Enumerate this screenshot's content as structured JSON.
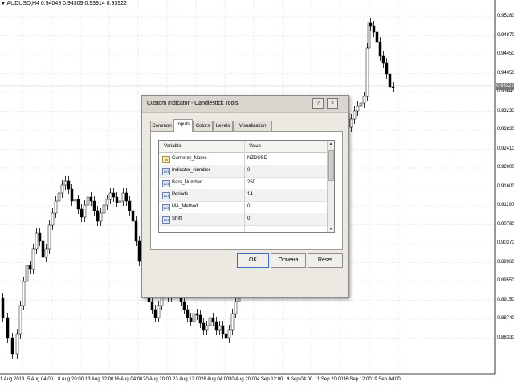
{
  "chart": {
    "symbol_line": "AUDUSD,H4  0.94049 0.94309 0.93914 0.93922",
    "current_price": "0.93922",
    "price_labels": [
      "0.95280",
      "0.94870",
      "0.94450",
      "0.94050",
      "0.93640",
      "0.93230",
      "0.92820",
      "0.92410",
      "0.92000",
      "0.91600",
      "0.91190",
      "0.90780",
      "0.90370",
      "0.89960",
      "0.89550",
      "0.89150",
      "0.88740",
      "0.88330"
    ],
    "time_labels": [
      "1 Aug 2013",
      "5 Aug 04:00",
      "8 Aug 20:00",
      "13 Aug 12:00",
      "16 Aug 04:00",
      "20 Aug 20:00",
      "23 Aug 12:00",
      "28 Aug 04:00",
      "30 Aug 20:00",
      "4 Sep 12:00",
      "9 Sep 04:00",
      "11 Sep 20:00",
      "16 Sep 12:00",
      "19 Sep 04:00"
    ],
    "colors": {
      "candle": "#000000",
      "grid": "#d9d9d9",
      "background": "#ffffff"
    }
  },
  "dialog": {
    "title": "Custom Indicator - Candlestick Tools",
    "help_glyph": "?",
    "close_glyph": "×",
    "tabs": [
      "Common",
      "Inputs",
      "Colors",
      "Levels",
      "Visualization"
    ],
    "active_tab": "Inputs",
    "columns": {
      "variable": "Variable",
      "value": "Value"
    },
    "rows": [
      {
        "icon": "ab",
        "variable": "Currency_Name",
        "value": "NZDUSD"
      },
      {
        "icon": "123",
        "variable": "Indicator_Number",
        "value": "0"
      },
      {
        "icon": "123",
        "variable": "Bars_Number",
        "value": "250"
      },
      {
        "icon": "123",
        "variable": "Periods",
        "value": "14"
      },
      {
        "icon": "123",
        "variable": "MA_Method",
        "value": "0"
      },
      {
        "icon": "123",
        "variable": "Shift",
        "value": "0"
      }
    ],
    "buttons": {
      "ok": "OK",
      "cancel": "Отмена",
      "reset": "Reset"
    }
  }
}
